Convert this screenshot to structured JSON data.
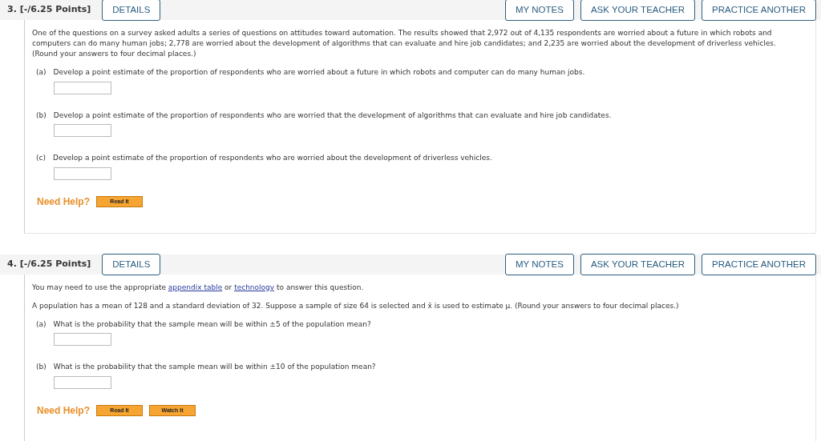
{
  "questions": [
    {
      "number": "3.",
      "points": "[-/6.25 Points]",
      "details": "DETAILS",
      "actions": [
        "MY NOTES",
        "ASK YOUR TEACHER",
        "PRACTICE ANOTHER"
      ],
      "intro": [
        [
          {
            "kind": "text",
            "text": "One of the questions on a survey asked adults a series of questions on attitudes toward automation. The results showed that 2,972 out of 4,135 respondents are worried about a future in which robots and computers can do many human jobs; 2,778 are worried about the development of algorithms that can evaluate and hire job candidates; and 2,235 are worried about the development of driverless vehicles. (Round your answers to four decimal places.)"
          }
        ]
      ],
      "parts": [
        {
          "label": "(a)",
          "text": "Develop a point estimate of the proportion of respondents who are worried about a future in which robots and computer can do many human jobs."
        },
        {
          "label": "(b)",
          "text": "Develop a point estimate of the proportion of respondents who are worried that the development of algorithms that can evaluate and hire job candidates."
        },
        {
          "label": "(c)",
          "text": "Develop a point estimate of the proportion of respondents who are worried about the development of driverless vehicles."
        }
      ],
      "help_label": "Need Help?",
      "help_buttons": [
        "Read It"
      ]
    },
    {
      "number": "4.",
      "points": "[-/6.25 Points]",
      "details": "DETAILS",
      "actions": [
        "MY NOTES",
        "ASK YOUR TEACHER",
        "PRACTICE ANOTHER"
      ],
      "intro": [
        [
          {
            "kind": "text",
            "text": "You may need to use the appropriate "
          },
          {
            "kind": "link",
            "text": "appendix table"
          },
          {
            "kind": "text",
            "text": " or "
          },
          {
            "kind": "link",
            "text": "technology"
          },
          {
            "kind": "text",
            "text": " to answer this question."
          }
        ],
        [
          {
            "kind": "text",
            "text": "A population has a mean of 128 and a standard deviation of 32. Suppose a sample of size 64 is selected and x̄ is used to estimate μ. (Round your answers to four decimal places.)"
          }
        ]
      ],
      "parts": [
        {
          "label": "(a)",
          "text": "What is the probability that the sample mean will be within ±5 of the population mean?"
        },
        {
          "label": "(b)",
          "text": "What is the probability that the sample mean will be within ±10 of the population mean?"
        }
      ],
      "help_label": "Need Help?",
      "help_buttons": [
        "Read It",
        "Watch It"
      ]
    }
  ]
}
